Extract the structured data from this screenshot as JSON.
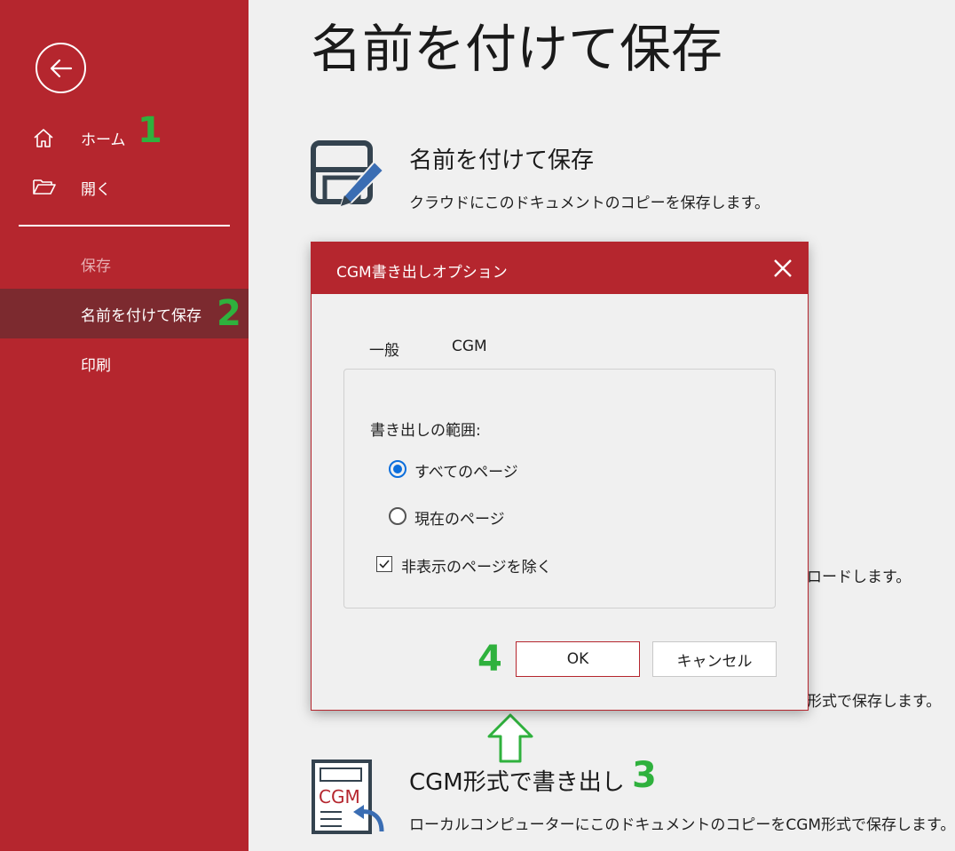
{
  "sidebar": {
    "items": [
      {
        "label": "ホーム",
        "icon": "home-icon"
      },
      {
        "label": "開く",
        "icon": "folder-open-icon"
      },
      {
        "label": "保存"
      },
      {
        "label": "名前を付けて保存"
      },
      {
        "label": "印刷"
      }
    ],
    "back_icon": "back-arrow-icon"
  },
  "steps": [
    "1",
    "2",
    "3",
    "4"
  ],
  "main": {
    "page_title": "名前を付けて保存",
    "options": [
      {
        "title": "名前を付けて保存",
        "desc": "クラウドにこのドキュメントのコピーを保存します。",
        "icon": "save-as-icon"
      },
      {
        "title": "CGM形式で書き出し",
        "desc": "ローカルコンピューターにこのドキュメントのコピーをCGM形式で保存します。",
        "icon": "cgm-export-icon"
      }
    ],
    "partial_texts": [
      "ロードします。",
      "形式で保存します。"
    ]
  },
  "dialog": {
    "title": "CGM書き出しオプション",
    "tabs": [
      "一般",
      "CGM"
    ],
    "range_label": "書き出しの範囲:",
    "radios": [
      {
        "label": "すべてのページ",
        "checked": true
      },
      {
        "label": "現在のページ",
        "checked": false
      }
    ],
    "checkbox": {
      "label": "非表示のページを除く",
      "checked": true
    },
    "ok_label": "OK",
    "cancel_label": "キャンセル"
  },
  "colors": {
    "accent": "#b5262e",
    "selected_nav": "#7c2a2f",
    "step_green": "#2fb13d",
    "radio_blue": "#0b6edc"
  }
}
